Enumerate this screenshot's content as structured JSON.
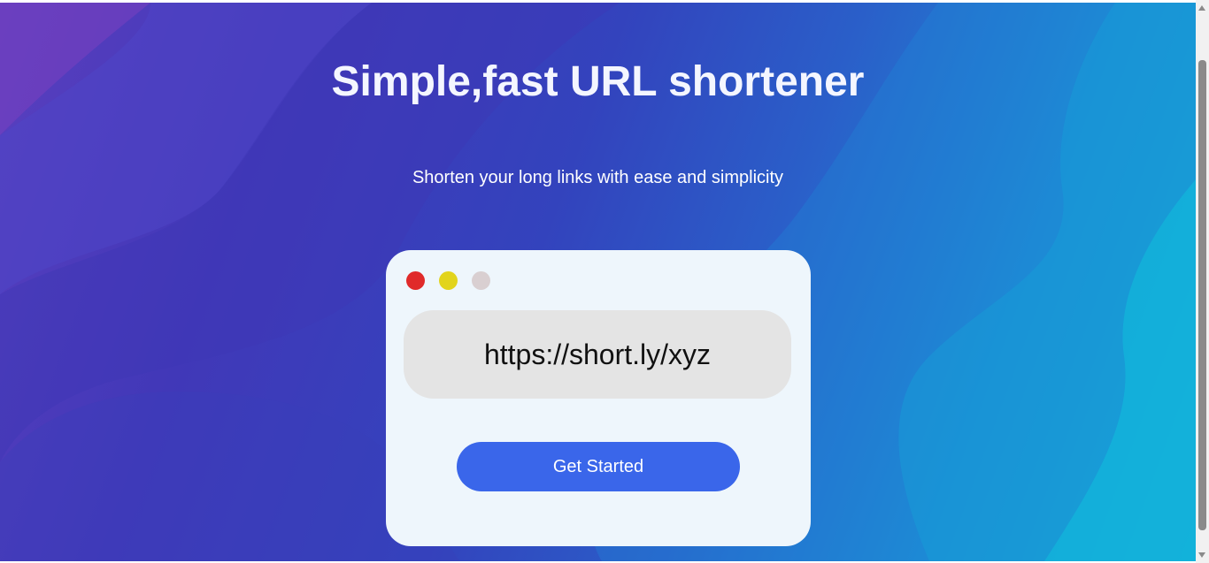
{
  "hero": {
    "title": "Simple,fast URL shortener",
    "subtitle": "Shorten your long links with ease and simplicity"
  },
  "preview_card": {
    "window_dots": [
      {
        "name": "close",
        "color": "#e02a2a"
      },
      {
        "name": "minimize",
        "color": "#e2d41c"
      },
      {
        "name": "maximize",
        "color": "#d9cfd1"
      }
    ],
    "short_url": "https://short.ly/xyz",
    "cta_label": "Get Started"
  },
  "colors": {
    "cta": "#3a66ea",
    "card_background": "#eef6fc",
    "url_box": "#e4e4e4"
  }
}
